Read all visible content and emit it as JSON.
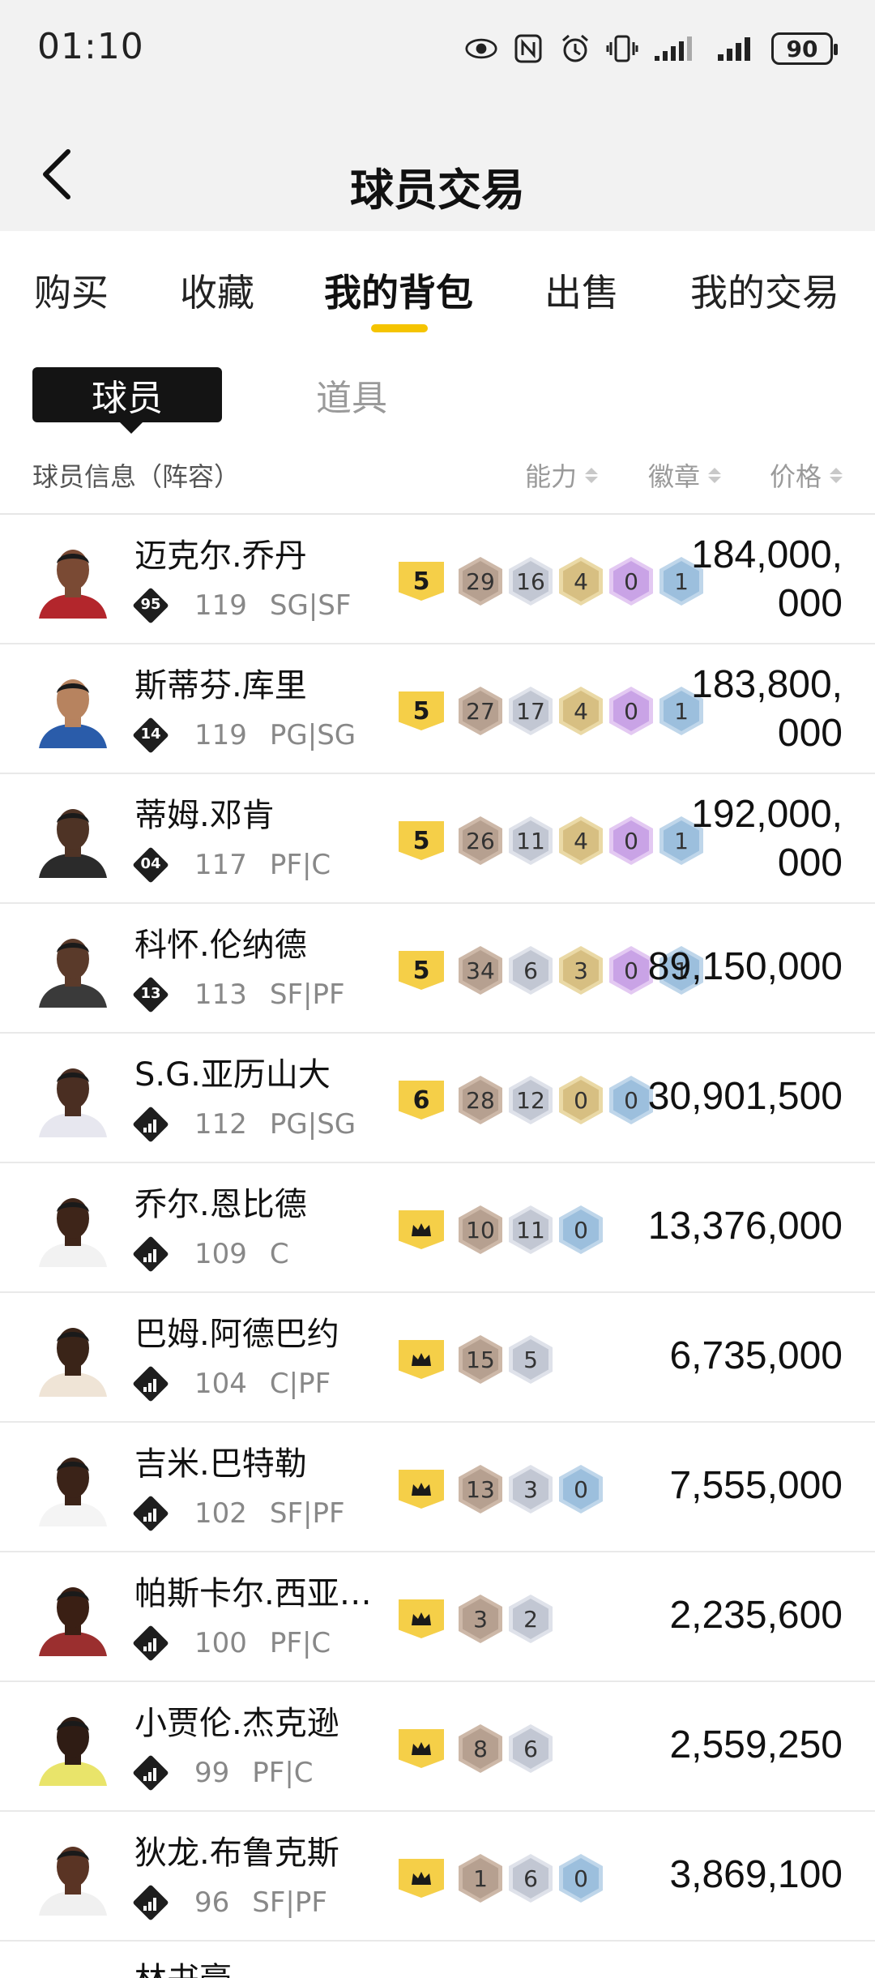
{
  "status": {
    "time": "01:10",
    "battery": "90"
  },
  "header": {
    "title": "球员交易"
  },
  "tabs": [
    {
      "label": "购买"
    },
    {
      "label": "收藏"
    },
    {
      "label": "我的背包"
    },
    {
      "label": "出售"
    },
    {
      "label": "我的交易"
    }
  ],
  "subtabs": {
    "player": "球员",
    "item": "道具"
  },
  "table_header": {
    "info": "球员信息（阵容）",
    "ability": "能力",
    "badge": "徽章",
    "price": "价格"
  },
  "players": [
    {
      "name": "迈克尔.乔丹",
      "rank": "95",
      "ovr": "119",
      "pos": "SG|SF",
      "star": "5",
      "price": "184,000,000",
      "avatar_color": "#7a4a34",
      "jersey": "#b3262c",
      "badges": [
        {
          "v": "29",
          "c": "bronze"
        },
        {
          "v": "16",
          "c": "silver"
        },
        {
          "v": "4",
          "c": "gold"
        },
        {
          "v": "0",
          "c": "purple"
        },
        {
          "v": "1",
          "c": "blue"
        }
      ]
    },
    {
      "name": "斯蒂芬.库里",
      "rank": "14",
      "ovr": "119",
      "pos": "PG|SG",
      "star": "5",
      "price": "183,800,000",
      "avatar_color": "#b7835f",
      "jersey": "#2a5caa",
      "badges": [
        {
          "v": "27",
          "c": "bronze"
        },
        {
          "v": "17",
          "c": "silver"
        },
        {
          "v": "4",
          "c": "gold"
        },
        {
          "v": "0",
          "c": "purple"
        },
        {
          "v": "1",
          "c": "blue"
        }
      ]
    },
    {
      "name": "蒂姆.邓肯",
      "rank": "04",
      "ovr": "117",
      "pos": "PF|C",
      "star": "5",
      "price": "192,000,000",
      "avatar_color": "#4e3325",
      "jersey": "#2b2b2b",
      "badges": [
        {
          "v": "26",
          "c": "bronze"
        },
        {
          "v": "11",
          "c": "silver"
        },
        {
          "v": "4",
          "c": "gold"
        },
        {
          "v": "0",
          "c": "purple"
        },
        {
          "v": "1",
          "c": "blue"
        }
      ]
    },
    {
      "name": "科怀.伦纳德",
      "rank": "13",
      "ovr": "113",
      "pos": "SF|PF",
      "star": "5",
      "price": "89,150,000",
      "avatar_color": "#5a3a2a",
      "jersey": "#3a3a3a",
      "badges": [
        {
          "v": "34",
          "c": "bronze"
        },
        {
          "v": "6",
          "c": "silver"
        },
        {
          "v": "3",
          "c": "gold"
        },
        {
          "v": "0",
          "c": "purple"
        },
        {
          "v": "1",
          "c": "blue"
        }
      ]
    },
    {
      "name": "S.G.亚历山大",
      "rank": "",
      "ovr": "112",
      "pos": "PG|SG",
      "star": "6",
      "price": "30,901,500",
      "avatar_color": "#4a2e22",
      "jersey": "#e7e7ef",
      "badges": [
        {
          "v": "28",
          "c": "bronze"
        },
        {
          "v": "12",
          "c": "silver"
        },
        {
          "v": "0",
          "c": "gold"
        },
        {
          "v": "0",
          "c": "blue"
        }
      ]
    },
    {
      "name": "乔尔.恩比德",
      "rank": "",
      "ovr": "109",
      "pos": "C",
      "star": "crown",
      "price": "13,376,000",
      "avatar_color": "#3e2519",
      "jersey": "#f2f2f2",
      "badges": [
        {
          "v": "10",
          "c": "bronze"
        },
        {
          "v": "11",
          "c": "silver"
        },
        {
          "v": "0",
          "c": "blue"
        }
      ]
    },
    {
      "name": "巴姆.阿德巴约",
      "rank": "",
      "ovr": "104",
      "pos": "C|PF",
      "star": "crown",
      "price": "6,735,000",
      "avatar_color": "#3a2418",
      "jersey": "#efe4d6",
      "badges": [
        {
          "v": "15",
          "c": "bronze"
        },
        {
          "v": "5",
          "c": "silver"
        }
      ]
    },
    {
      "name": "吉米.巴特勒",
      "rank": "",
      "ovr": "102",
      "pos": "SF|PF",
      "star": "crown",
      "price": "7,555,000",
      "avatar_color": "#3b2318",
      "jersey": "#f4f4f4",
      "badges": [
        {
          "v": "13",
          "c": "bronze"
        },
        {
          "v": "3",
          "c": "silver"
        },
        {
          "v": "0",
          "c": "blue"
        }
      ]
    },
    {
      "name": "帕斯卡尔.西亚卡姆",
      "rank": "",
      "ovr": "100",
      "pos": "PF|C",
      "star": "crown",
      "price": "2,235,600",
      "avatar_color": "#3a1f14",
      "jersey": "#9b2f2f",
      "badges": [
        {
          "v": "3",
          "c": "bronze"
        },
        {
          "v": "2",
          "c": "silver"
        }
      ]
    },
    {
      "name": "小贾伦.杰克逊",
      "rank": "",
      "ovr": "99",
      "pos": "PF|C",
      "star": "crown",
      "price": "2,559,250",
      "avatar_color": "#2f1c14",
      "jersey": "#e9e46a",
      "badges": [
        {
          "v": "8",
          "c": "bronze"
        },
        {
          "v": "6",
          "c": "silver"
        }
      ]
    },
    {
      "name": "狄龙.布鲁克斯",
      "rank": "",
      "ovr": "96",
      "pos": "SF|PF",
      "star": "crown",
      "price": "3,869,100",
      "avatar_color": "#5a3424",
      "jersey": "#f0f0f0",
      "badges": [
        {
          "v": "1",
          "c": "bronze"
        },
        {
          "v": "6",
          "c": "silver"
        },
        {
          "v": "0",
          "c": "blue"
        }
      ]
    }
  ],
  "partial_row": {
    "name": "林书豪"
  }
}
